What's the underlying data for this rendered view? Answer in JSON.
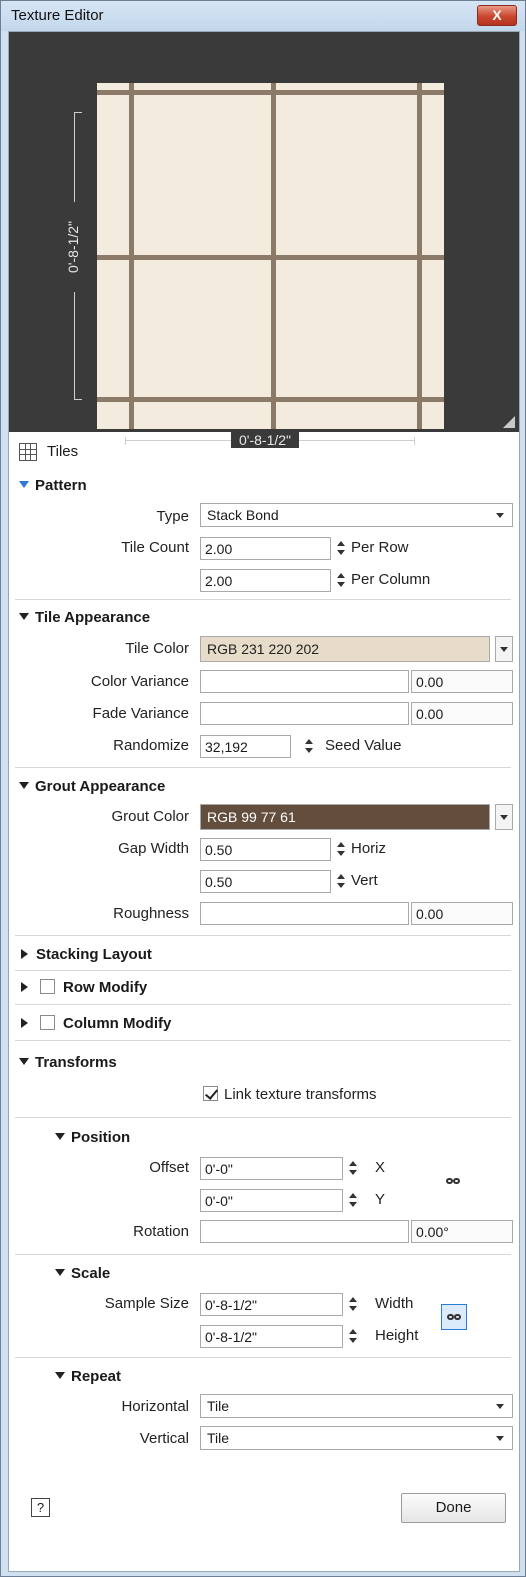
{
  "window": {
    "title": "Texture Editor",
    "close_label": "X"
  },
  "preview": {
    "height_label": "0'-8-1/2\"",
    "width_label": "0'-8-1/2\""
  },
  "header": {
    "tiles_label": "Tiles"
  },
  "pattern": {
    "section_label": "Pattern",
    "type_label": "Type",
    "type_value": "Stack Bond",
    "tile_count_label": "Tile Count",
    "per_row_value": "2.00",
    "per_row_unit": "Per Row",
    "per_column_value": "2.00",
    "per_column_unit": "Per Column"
  },
  "tile_appearance": {
    "section_label": "Tile Appearance",
    "tile_color_label": "Tile Color",
    "tile_color_value": "RGB 231 220 202",
    "tile_color_hex": "#e7dcca",
    "color_variance_label": "Color Variance",
    "color_variance_value": "0.00",
    "fade_variance_label": "Fade Variance",
    "fade_variance_value": "0.00",
    "randomize_label": "Randomize",
    "randomize_value": "32,192",
    "seed_label": "Seed Value"
  },
  "grout_appearance": {
    "section_label": "Grout Appearance",
    "grout_color_label": "Grout Color",
    "grout_color_value": "RGB 99 77 61",
    "grout_color_hex": "#634d3d",
    "gap_width_label": "Gap Width",
    "horiz_value": "0.50",
    "horiz_unit": "Horiz",
    "vert_value": "0.50",
    "vert_unit": "Vert",
    "roughness_label": "Roughness",
    "roughness_value": "0.00"
  },
  "stacking_layout": {
    "section_label": "Stacking Layout"
  },
  "row_modify": {
    "section_label": "Row Modify",
    "checked": false
  },
  "column_modify": {
    "section_label": "Column Modify",
    "checked": false
  },
  "transforms": {
    "section_label": "Transforms",
    "link_label": "Link texture transforms",
    "link_checked": true,
    "position": {
      "section_label": "Position",
      "offset_label": "Offset",
      "x_value": "0'-0\"",
      "x_unit": "X",
      "y_value": "0'-0\"",
      "y_unit": "Y",
      "rotation_label": "Rotation",
      "rotation_value": "0.00°"
    },
    "scale": {
      "section_label": "Scale",
      "sample_size_label": "Sample Size",
      "width_value": "0'-8-1/2\"",
      "width_unit": "Width",
      "height_value": "0'-8-1/2\"",
      "height_unit": "Height"
    },
    "repeat": {
      "section_label": "Repeat",
      "horizontal_label": "Horizontal",
      "horizontal_value": "Tile",
      "vertical_label": "Vertical",
      "vertical_value": "Tile"
    }
  },
  "footer": {
    "help_label": "?",
    "done_label": "Done"
  }
}
